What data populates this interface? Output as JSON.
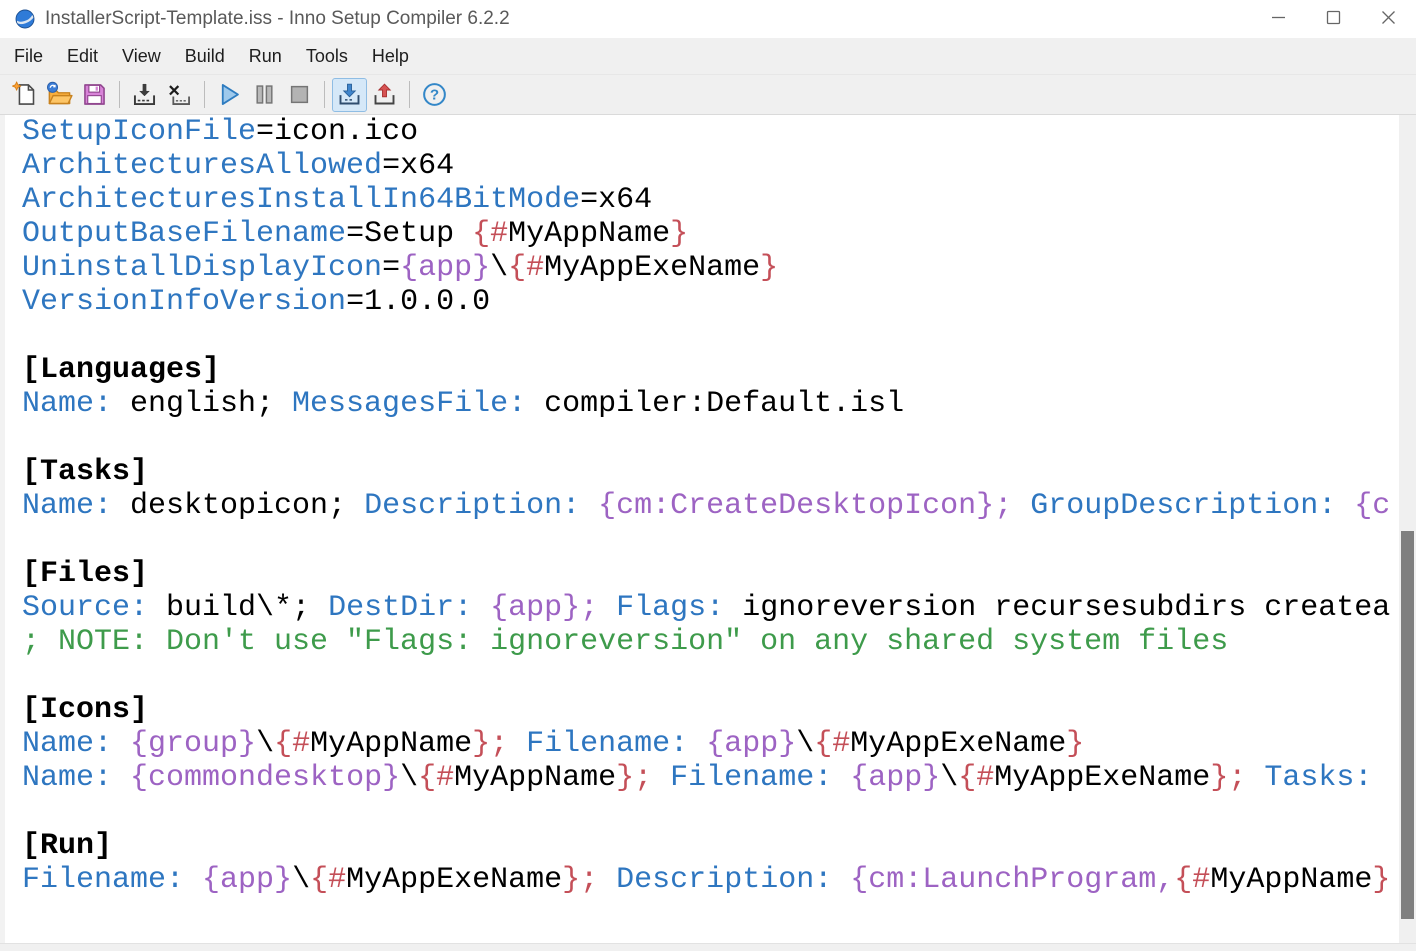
{
  "window": {
    "title": "InstallerScript-Template.iss - Inno Setup Compiler 6.2.2",
    "controls": [
      {
        "name": "minimize-button",
        "icon": "minimize-icon"
      },
      {
        "name": "maximize-button",
        "icon": "maximize-icon"
      },
      {
        "name": "close-button",
        "icon": "close-icon"
      }
    ]
  },
  "menu": {
    "items": [
      "File",
      "Edit",
      "View",
      "Build",
      "Run",
      "Tools",
      "Help"
    ]
  },
  "toolbar": {
    "buttons": [
      {
        "name": "new-script-button",
        "icon": "new-file-icon"
      },
      {
        "name": "open-script-button",
        "icon": "open-folder-icon"
      },
      {
        "name": "save-script-button",
        "icon": "save-icon"
      },
      {
        "sep": true
      },
      {
        "name": "compile-button",
        "icon": "compile-icon"
      },
      {
        "name": "stop-compile-button",
        "icon": "stop-compile-icon"
      },
      {
        "sep": true
      },
      {
        "name": "run-button",
        "icon": "run-icon"
      },
      {
        "name": "pause-button",
        "icon": "pause-icon"
      },
      {
        "name": "terminate-button",
        "icon": "stop-icon"
      },
      {
        "sep": true
      },
      {
        "name": "target-setup-button",
        "icon": "install-arrow-icon",
        "active": true
      },
      {
        "name": "target-uninstall-button",
        "icon": "uninstall-arrow-icon"
      },
      {
        "sep": true
      },
      {
        "name": "help-button",
        "icon": "help-icon"
      }
    ],
    "active_bg": "#D5E8F8",
    "active_border": "#8FBDE4"
  },
  "editor": {
    "colors": {
      "key": "#2E76C0",
      "val": "#000000",
      "const": "#9D63C3",
      "pre": "#C44F58",
      "comment": "#3E9B4B",
      "section": "#000000"
    },
    "lines": [
      [
        [
          "key",
          "SetupIconFile"
        ],
        [
          "val",
          "=icon.ico"
        ]
      ],
      [
        [
          "key",
          "ArchitecturesAllowed"
        ],
        [
          "val",
          "=x64"
        ]
      ],
      [
        [
          "key",
          "ArchitecturesInstallIn64BitMode"
        ],
        [
          "val",
          "=x64"
        ]
      ],
      [
        [
          "key",
          "OutputBaseFilename"
        ],
        [
          "val",
          "=Setup "
        ],
        [
          "pre",
          "{#"
        ],
        [
          "val",
          "MyAppName"
        ],
        [
          "pre",
          "}"
        ]
      ],
      [
        [
          "key",
          "UninstallDisplayIcon"
        ],
        [
          "val",
          "="
        ],
        [
          "const",
          "{app}"
        ],
        [
          "val",
          "\\"
        ],
        [
          "pre",
          "{#"
        ],
        [
          "val",
          "MyAppExeName"
        ],
        [
          "pre",
          "}"
        ]
      ],
      [
        [
          "key",
          "VersionInfoVersion"
        ],
        [
          "val",
          "=1.0.0.0"
        ]
      ],
      [],
      [
        [
          "section",
          "[Languages]"
        ]
      ],
      [
        [
          "key",
          "Name:"
        ],
        [
          "val",
          " english; "
        ],
        [
          "key",
          "MessagesFile:"
        ],
        [
          "val",
          " compiler:Default.isl"
        ]
      ],
      [],
      [
        [
          "section",
          "[Tasks]"
        ]
      ],
      [
        [
          "key",
          "Name:"
        ],
        [
          "val",
          " desktopicon; "
        ],
        [
          "key",
          "Description:"
        ],
        [
          "val",
          " "
        ],
        [
          "const",
          "{cm:CreateDesktopIcon};"
        ],
        [
          "val",
          " "
        ],
        [
          "key",
          "GroupDescription:"
        ],
        [
          "val",
          " "
        ],
        [
          "const",
          "{c"
        ]
      ],
      [],
      [
        [
          "section",
          "[Files]"
        ]
      ],
      [
        [
          "key",
          "Source:"
        ],
        [
          "val",
          " build\\*; "
        ],
        [
          "key",
          "DestDir:"
        ],
        [
          "val",
          " "
        ],
        [
          "const",
          "{app};"
        ],
        [
          "val",
          " "
        ],
        [
          "key",
          "Flags:"
        ],
        [
          "val",
          " ignoreversion recursesubdirs createa"
        ]
      ],
      [
        [
          "comment",
          "; NOTE: Don't use \"Flags: ignoreversion\" on any shared system files"
        ]
      ],
      [],
      [
        [
          "section",
          "[Icons]"
        ]
      ],
      [
        [
          "key",
          "Name:"
        ],
        [
          "val",
          " "
        ],
        [
          "const",
          "{group}"
        ],
        [
          "val",
          "\\"
        ],
        [
          "pre",
          "{#"
        ],
        [
          "val",
          "MyAppName"
        ],
        [
          "pre",
          "};"
        ],
        [
          "val",
          " "
        ],
        [
          "key",
          "Filename:"
        ],
        [
          "val",
          " "
        ],
        [
          "const",
          "{app}"
        ],
        [
          "val",
          "\\"
        ],
        [
          "pre",
          "{#"
        ],
        [
          "val",
          "MyAppExeName"
        ],
        [
          "pre",
          "}"
        ]
      ],
      [
        [
          "key",
          "Name:"
        ],
        [
          "val",
          " "
        ],
        [
          "const",
          "{commondesktop}"
        ],
        [
          "val",
          "\\"
        ],
        [
          "pre",
          "{#"
        ],
        [
          "val",
          "MyAppName"
        ],
        [
          "pre",
          "};"
        ],
        [
          "val",
          " "
        ],
        [
          "key",
          "Filename:"
        ],
        [
          "val",
          " "
        ],
        [
          "const",
          "{app}"
        ],
        [
          "val",
          "\\"
        ],
        [
          "pre",
          "{#"
        ],
        [
          "val",
          "MyAppExeName"
        ],
        [
          "pre",
          "};"
        ],
        [
          "val",
          " "
        ],
        [
          "key",
          "Tasks:"
        ]
      ],
      [],
      [
        [
          "section",
          "[Run]"
        ]
      ],
      [
        [
          "key",
          "Filename:"
        ],
        [
          "val",
          " "
        ],
        [
          "const",
          "{app}"
        ],
        [
          "val",
          "\\"
        ],
        [
          "pre",
          "{#"
        ],
        [
          "val",
          "MyAppExeName"
        ],
        [
          "pre",
          "};"
        ],
        [
          "val",
          " "
        ],
        [
          "key",
          "Description:"
        ],
        [
          "val",
          " "
        ],
        [
          "const",
          "{cm:LaunchProgram,"
        ],
        [
          "pre",
          "{#"
        ],
        [
          "val",
          "MyAppName"
        ],
        [
          "pre",
          "}"
        ]
      ]
    ]
  },
  "scrollbar": {
    "track_color": "#F0F0F0",
    "thumb_color": "#7F7F7F"
  }
}
